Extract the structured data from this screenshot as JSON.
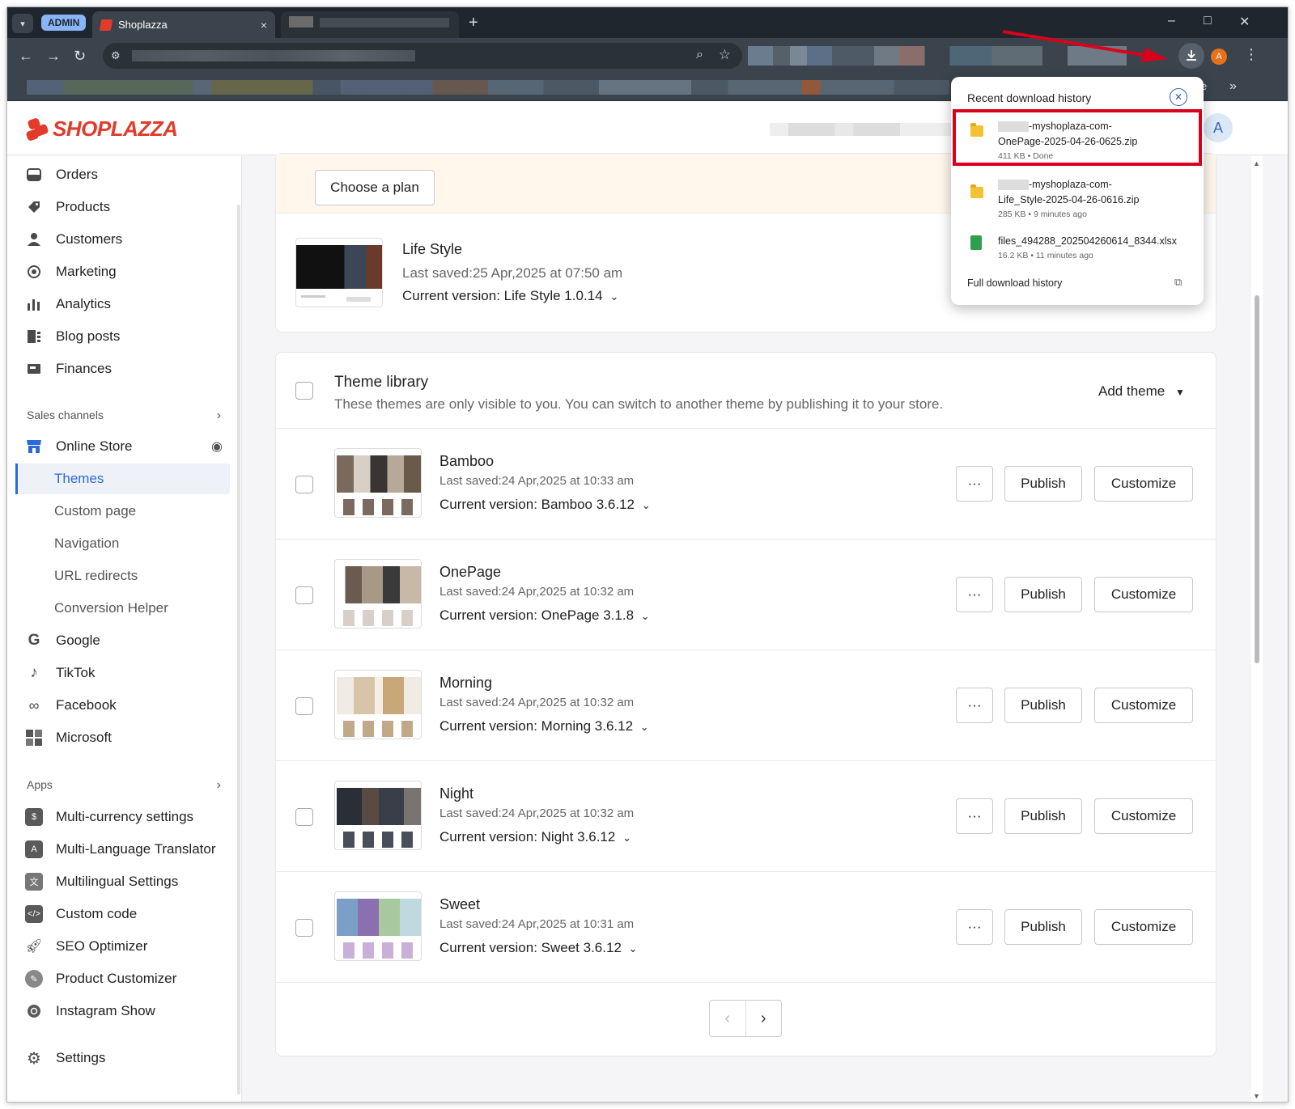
{
  "browser": {
    "tab_group_label": "ADMIN",
    "active_tab_title": "Shoplazza",
    "tab_close": "×",
    "new_tab": "+",
    "minimize": "–",
    "maximize": "□",
    "close": "✕",
    "more_bookmarks": "»",
    "bookmark_trunc": "e",
    "profile_initial": "A"
  },
  "header": {
    "logo_text": "SHOPLAZZA",
    "avatar_initial": "A"
  },
  "sidebar": {
    "main_items": [
      {
        "label": "Orders",
        "icon": "orders-icon"
      },
      {
        "label": "Products",
        "icon": "products-icon"
      },
      {
        "label": "Customers",
        "icon": "customers-icon"
      },
      {
        "label": "Marketing",
        "icon": "marketing-icon"
      },
      {
        "label": "Analytics",
        "icon": "analytics-icon"
      },
      {
        "label": "Blog posts",
        "icon": "blog-icon"
      },
      {
        "label": "Finances",
        "icon": "finances-icon"
      }
    ],
    "sales_channels_label": "Sales channels",
    "online_store_label": "Online Store",
    "online_store_sub": [
      "Themes",
      "Custom page",
      "Navigation",
      "URL redirects",
      "Conversion Helper"
    ],
    "channels": [
      "Google",
      "TikTok",
      "Facebook",
      "Microsoft"
    ],
    "apps_label": "Apps",
    "apps": [
      "Multi-currency settings",
      "Multi-Language Translator",
      "Multilingual Settings",
      "Custom code",
      "SEO Optimizer",
      "Product Customizer",
      "Instagram Show"
    ],
    "settings_label": "Settings"
  },
  "current_theme": {
    "choose_plan_label": "Choose a plan",
    "name": "Life Style",
    "saved": "Last saved:25 Apr,2025 at 07:50 am",
    "version": "Current version: Life Style 1.0.14"
  },
  "theme_library": {
    "title": "Theme library",
    "description": "These themes are only visible to you. You can switch to another theme by publishing it to your store.",
    "add_theme_label": "Add theme",
    "more_label": "···",
    "publish_label": "Publish",
    "customize_label": "Customize",
    "themes": [
      {
        "name": "Bamboo",
        "saved": "Last saved:24 Apr,2025 at 10:33 am",
        "version": "Current version: Bamboo 3.6.12"
      },
      {
        "name": "OnePage",
        "saved": "Last saved:24 Apr,2025 at 10:32 am",
        "version": "Current version: OnePage 3.1.8"
      },
      {
        "name": "Morning",
        "saved": "Last saved:24 Apr,2025 at 10:32 am",
        "version": "Current version: Morning 3.6.12"
      },
      {
        "name": "Night",
        "saved": "Last saved:24 Apr,2025 at 10:32 am",
        "version": "Current version: Night 3.6.12"
      },
      {
        "name": "Sweet",
        "saved": "Last saved:24 Apr,2025 at 10:31 am",
        "version": "Current version: Sweet 3.6.12"
      }
    ]
  },
  "downloads": {
    "title": "Recent download history",
    "items": [
      {
        "line1": "-myshoplaza-com-",
        "line2": "OnePage-2025-04-26-0625.zip",
        "meta": "411 KB • Done",
        "type": "zip"
      },
      {
        "line1": "-myshoplaza-com-",
        "line2": "Life_Style-2025-04-26-0616.zip",
        "meta": "285 KB • 9 minutes ago",
        "type": "zip"
      },
      {
        "line1": "files_494288_202504260614_8344.xlsx",
        "line2": "",
        "meta": "16.2 KB • 11 minutes ago",
        "type": "xlsx"
      }
    ],
    "full_history_label": "Full download history"
  },
  "colors": {
    "brand": "#e23b2b",
    "highlight_box": "#d9001b",
    "active_nav": "#2d6ad8"
  }
}
